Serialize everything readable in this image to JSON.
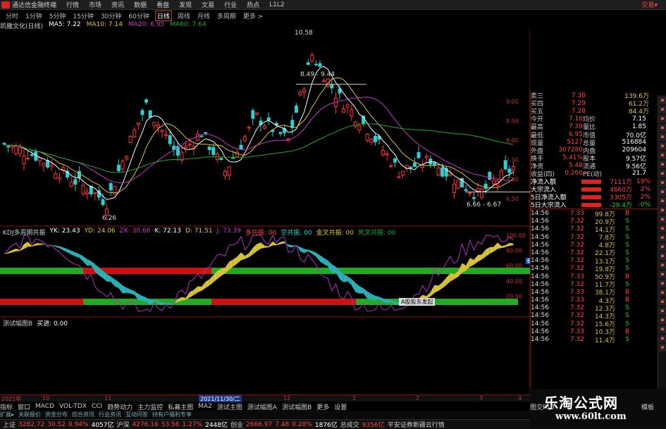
{
  "app": {
    "title": "通达信金融终端",
    "trade_label": "交易▾"
  },
  "menu": [
    "行情",
    "市场",
    "资讯",
    "数据",
    "看盘",
    "发现",
    "文易",
    "行业",
    "热点",
    "L1L2"
  ],
  "periods": [
    {
      "label": "分时",
      "active": false
    },
    {
      "label": "1分钟",
      "active": false
    },
    {
      "label": "5分钟",
      "active": false
    },
    {
      "label": "15分钟",
      "active": false
    },
    {
      "label": "30分钟",
      "active": false
    },
    {
      "label": "60分钟",
      "active": false
    },
    {
      "label": "日线",
      "active": true
    },
    {
      "label": "周线",
      "active": false
    },
    {
      "label": "月线",
      "active": false
    },
    {
      "label": "多周期",
      "active": false
    },
    {
      "label": "更多 >",
      "active": false
    }
  ],
  "ma_legend": {
    "stock": "凯撒文化(日线)",
    "ma5": "MA5: 7.22",
    "ma10": "MA10: 7.14",
    "ma20": "MA20: 6.95",
    "ma60": "MA60: 7.64"
  },
  "price_annotations": {
    "high": "10.58",
    "low": "6.26",
    "range_hi": "8.49 - 9.44",
    "range_lo": "6.66 - 6.67"
  },
  "price_axis": [
    "9.00",
    "8.50",
    "8.00",
    "7.50",
    "7.00",
    "6.50"
  ],
  "kdj_legend": {
    "name": "KDJ多周期共振",
    "yk": "YK: 23.43",
    "yd": "YD: 24.06",
    "zk": "ZK: 30.68",
    "k": "K: 72.13",
    "d": "D: 71.51",
    "j": "J: 73.39",
    "multi": "多共振: 00",
    "short": "空共振: 00",
    "gold": "金叉共振: 00",
    "full": "死叉共振: 00"
  },
  "kdj_axis": [
    "100.00",
    "80.00",
    "60.00",
    "40.00",
    "20.00"
  ],
  "kdj_current": "67.35",
  "tooltip": "A股股东发起",
  "bl3_legend": {
    "name": "测试幅图B",
    "value": "买进: 0.00"
  },
  "quotes_top": [
    {
      "label": "卖三",
      "price": "7.30",
      "vol": "139.6万"
    },
    {
      "label": "买四",
      "price": "7.29",
      "vol": "61.2万"
    },
    {
      "label": "买五",
      "price": "7.28",
      "vol": "84.4万"
    }
  ],
  "stats": [
    [
      "今开",
      "7.10",
      "均价",
      "7.15"
    ],
    [
      "最高",
      "7.39",
      "量比",
      "1.85"
    ],
    [
      "最低",
      "6.95",
      "市值",
      "70.0亿"
    ],
    [
      "现量",
      "5127",
      "总量",
      "516884"
    ],
    [
      "外盘",
      "307280",
      "内盘",
      "209604"
    ],
    [
      "换手",
      "5.41%",
      "股本",
      "9.57亿"
    ],
    [
      "净资",
      "5.48",
      "流通",
      "9.56亿"
    ],
    [
      "收益(四)",
      "0.260",
      "PE(动)",
      "21.7"
    ]
  ],
  "flows": [
    {
      "label": "净流入额",
      "value": "7111万",
      "pct": "19%"
    },
    {
      "label": "大宗流入",
      "value": "4660万",
      "pct": "2%"
    },
    {
      "label": "5日净流入额",
      "value": "3305万",
      "pct": "2%"
    },
    {
      "label": "5日大宗流入",
      "value": "-29.4万",
      "pct": "-0%"
    }
  ],
  "ticks": [
    {
      "t": "14:56",
      "p": "7.33",
      "v": "99.8万",
      "s": "B"
    },
    {
      "t": "14:56",
      "p": "7.32",
      "v": "20.9万",
      "s": "S"
    },
    {
      "t": "14:56",
      "p": "7.32",
      "v": "14.1万",
      "s": "S"
    },
    {
      "t": "14:56",
      "p": "7.32",
      "v": "7.8万",
      "s": "S"
    },
    {
      "t": "14:56",
      "p": "7.32",
      "v": "4.8万",
      "s": "S"
    },
    {
      "t": "14:56",
      "p": "7.32",
      "v": "22.1万",
      "s": "S"
    },
    {
      "t": "14:56",
      "p": "7.32",
      "v": "13.1万",
      "s": "S"
    },
    {
      "t": "14:56",
      "p": "7.32",
      "v": "19.8万",
      "s": "S"
    },
    {
      "t": "14:56",
      "p": "7.33",
      "v": "50.9万",
      "s": "B"
    },
    {
      "t": "14:56",
      "p": "7.32",
      "v": "11.7万",
      "s": "S"
    },
    {
      "t": "14:56",
      "p": "7.33",
      "v": "38.1万",
      "s": "B"
    },
    {
      "t": "14:56",
      "p": "7.33",
      "v": "4.3万",
      "s": "B"
    },
    {
      "t": "14:56",
      "p": "7.32",
      "v": "12.3万",
      "s": "S"
    },
    {
      "t": "14:56",
      "p": "7.32",
      "v": "14.3万",
      "s": "S"
    },
    {
      "t": "14:56",
      "p": "7.32",
      "v": "15.6万",
      "s": "S"
    },
    {
      "t": "14:56",
      "p": "7.33",
      "v": "10.3万",
      "s": "B"
    },
    {
      "t": "14:56",
      "p": "7.32",
      "v": "11.4万",
      "s": "S"
    }
  ],
  "dates": [
    "2021年",
    "10",
    "11",
    "2021/11/30/二",
    "12",
    "1",
    "2",
    "3",
    "4"
  ],
  "tabs": [
    "指标",
    "窗口",
    "MACD",
    "VOL-TDX",
    "CCI",
    "趋势动力",
    "主力监控",
    "私募主图",
    "MA2",
    "测试主图",
    "测试幅图A",
    "测试幅图B",
    "更多",
    "设置"
  ],
  "subtabs": [
    "扩展▸",
    "关联报价",
    "资金分布",
    "综合资讯",
    "行业资讯",
    "互动问答",
    "持有户福利专享"
  ],
  "right_footer": {
    "left": "图交F10",
    "right": "模板"
  },
  "status": [
    {
      "label": "上证",
      "v1": "3282.72",
      "v2": "30.52",
      "v3": "0.94%",
      "v4": "4057亿"
    },
    {
      "label": "沪深",
      "v1": "4276.16",
      "v2": "53.56",
      "v3": "1.27%",
      "v4": "2448亿"
    },
    {
      "label": "创业",
      "v1": "2666.97",
      "v2": "7.48",
      "v3": "0.28%",
      "v4": "1876亿"
    },
    {
      "label": "总成交",
      "v1": "9356亿",
      "v2": "",
      "v3": "",
      "v4": ""
    }
  ],
  "status_end": "平安证券新疆云行情",
  "brand": {
    "name": "乐淘公式网",
    "url": "www.60lt.com"
  },
  "colors": {
    "up": "#ff3333",
    "down": "#33cccc",
    "ma5": "#ffffff",
    "ma10": "#e0c040",
    "ma20": "#cc33cc",
    "ma60": "#22aa22"
  }
}
